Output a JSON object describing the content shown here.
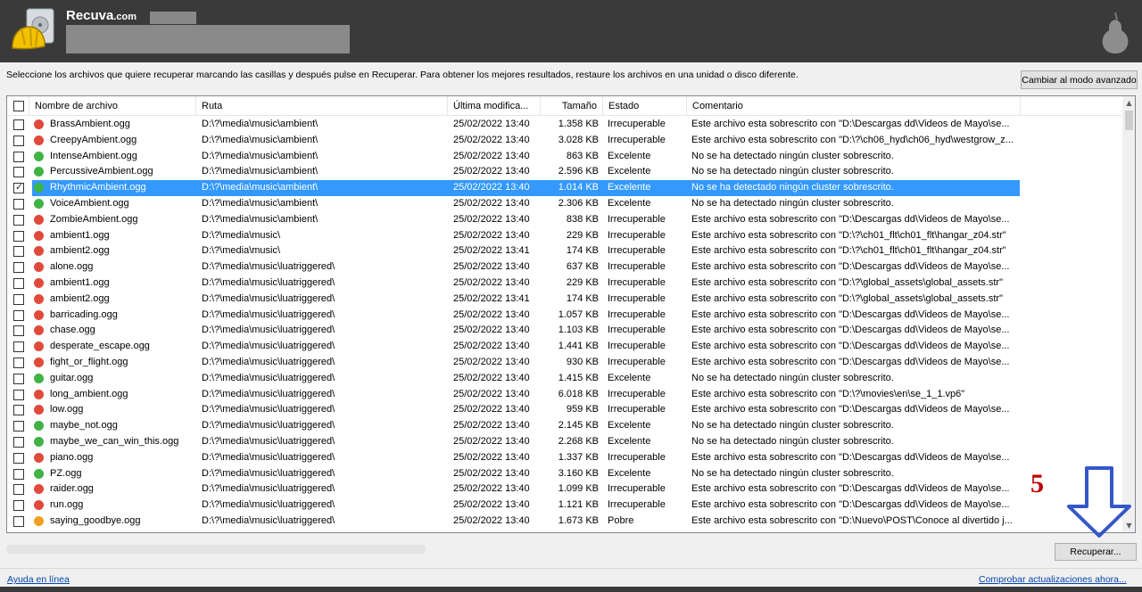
{
  "app": {
    "title": "Recuva",
    "title_suffix": ".com"
  },
  "instructions": "Seleccione los archivos que quiere recuperar marcando las casillas y después pulse en Recuperar. Para obtener los mejores resultados, restaure los archivos en una unidad o disco diferente.",
  "buttons": {
    "advanced": "Cambiar al modo avanzado",
    "recover": "Recuperar..."
  },
  "columns": [
    "Nombre de archivo",
    "Ruta",
    "Última modifica...",
    "Tamaño",
    "Estado",
    "Comentario"
  ],
  "status_colors": {
    "red": "#e04a3a",
    "green": "#3fb344",
    "orange": "#f0a020",
    "selected_row": "#3399ff"
  },
  "rows": [
    {
      "checked": false,
      "status": "red",
      "name": "BrassAmbient.ogg",
      "path": "D:\\?\\media\\music\\ambient\\",
      "date": "25/02/2022 13:40",
      "size": "1.358 KB",
      "state": "Irrecuperable",
      "comment": "Este archivo esta sobrescrito con \"D:\\Descargas dd\\Videos de Mayo\\se..."
    },
    {
      "checked": false,
      "status": "red",
      "name": "CreepyAmbient.ogg",
      "path": "D:\\?\\media\\music\\ambient\\",
      "date": "25/02/2022 13:40",
      "size": "3.028 KB",
      "state": "Irrecuperable",
      "comment": "Este archivo esta sobrescrito con \"D:\\?\\ch06_hyd\\ch06_hyd\\westgrow_z..."
    },
    {
      "checked": false,
      "status": "green",
      "name": "IntenseAmbient.ogg",
      "path": "D:\\?\\media\\music\\ambient\\",
      "date": "25/02/2022 13:40",
      "size": "863 KB",
      "state": "Excelente",
      "comment": "No se ha detectado ningún cluster sobrescrito."
    },
    {
      "checked": false,
      "status": "green",
      "name": "PercussiveAmbient.ogg",
      "path": "D:\\?\\media\\music\\ambient\\",
      "date": "25/02/2022 13:40",
      "size": "2.596 KB",
      "state": "Excelente",
      "comment": "No se ha detectado ningún cluster sobrescrito."
    },
    {
      "checked": true,
      "status": "green",
      "selected": true,
      "name": "RhythmicAmbient.ogg",
      "path": "D:\\?\\media\\music\\ambient\\",
      "date": "25/02/2022 13:40",
      "size": "1.014 KB",
      "state": "Excelente",
      "comment": "No se ha detectado ningún cluster sobrescrito."
    },
    {
      "checked": false,
      "status": "green",
      "name": "VoiceAmbient.ogg",
      "path": "D:\\?\\media\\music\\ambient\\",
      "date": "25/02/2022 13:40",
      "size": "2.306 KB",
      "state": "Excelente",
      "comment": "No se ha detectado ningún cluster sobrescrito."
    },
    {
      "checked": false,
      "status": "red",
      "name": "ZombieAmbient.ogg",
      "path": "D:\\?\\media\\music\\ambient\\",
      "date": "25/02/2022 13:40",
      "size": "838 KB",
      "state": "Irrecuperable",
      "comment": "Este archivo esta sobrescrito con \"D:\\Descargas dd\\Videos de Mayo\\se..."
    },
    {
      "checked": false,
      "status": "red",
      "name": "ambient1.ogg",
      "path": "D:\\?\\media\\music\\",
      "date": "25/02/2022 13:40",
      "size": "229 KB",
      "state": "Irrecuperable",
      "comment": "Este archivo esta sobrescrito con \"D:\\?\\ch01_flt\\ch01_flt\\hangar_z04.str\""
    },
    {
      "checked": false,
      "status": "red",
      "name": "ambient2.ogg",
      "path": "D:\\?\\media\\music\\",
      "date": "25/02/2022 13:41",
      "size": "174 KB",
      "state": "Irrecuperable",
      "comment": "Este archivo esta sobrescrito con \"D:\\?\\ch01_flt\\ch01_flt\\hangar_z04.str\""
    },
    {
      "checked": false,
      "status": "red",
      "name": "alone.ogg",
      "path": "D:\\?\\media\\music\\luatriggered\\",
      "date": "25/02/2022 13:40",
      "size": "637 KB",
      "state": "Irrecuperable",
      "comment": "Este archivo esta sobrescrito con \"D:\\Descargas dd\\Videos de Mayo\\se..."
    },
    {
      "checked": false,
      "status": "red",
      "name": "ambient1.ogg",
      "path": "D:\\?\\media\\music\\luatriggered\\",
      "date": "25/02/2022 13:40",
      "size": "229 KB",
      "state": "Irrecuperable",
      "comment": "Este archivo esta sobrescrito con \"D:\\?\\global_assets\\global_assets.str\""
    },
    {
      "checked": false,
      "status": "red",
      "name": "ambient2.ogg",
      "path": "D:\\?\\media\\music\\luatriggered\\",
      "date": "25/02/2022 13:41",
      "size": "174 KB",
      "state": "Irrecuperable",
      "comment": "Este archivo esta sobrescrito con \"D:\\?\\global_assets\\global_assets.str\""
    },
    {
      "checked": false,
      "status": "red",
      "name": "barricading.ogg",
      "path": "D:\\?\\media\\music\\luatriggered\\",
      "date": "25/02/2022 13:40",
      "size": "1.057 KB",
      "state": "Irrecuperable",
      "comment": "Este archivo esta sobrescrito con \"D:\\Descargas dd\\Videos de Mayo\\se..."
    },
    {
      "checked": false,
      "status": "red",
      "name": "chase.ogg",
      "path": "D:\\?\\media\\music\\luatriggered\\",
      "date": "25/02/2022 13:40",
      "size": "1.103 KB",
      "state": "Irrecuperable",
      "comment": "Este archivo esta sobrescrito con \"D:\\Descargas dd\\Videos de Mayo\\se..."
    },
    {
      "checked": false,
      "status": "red",
      "name": "desperate_escape.ogg",
      "path": "D:\\?\\media\\music\\luatriggered\\",
      "date": "25/02/2022 13:40",
      "size": "1.441 KB",
      "state": "Irrecuperable",
      "comment": "Este archivo esta sobrescrito con \"D:\\Descargas dd\\Videos de Mayo\\se..."
    },
    {
      "checked": false,
      "status": "red",
      "name": "fight_or_flight.ogg",
      "path": "D:\\?\\media\\music\\luatriggered\\",
      "date": "25/02/2022 13:40",
      "size": "930 KB",
      "state": "Irrecuperable",
      "comment": "Este archivo esta sobrescrito con \"D:\\Descargas dd\\Videos de Mayo\\se..."
    },
    {
      "checked": false,
      "status": "green",
      "name": "guitar.ogg",
      "path": "D:\\?\\media\\music\\luatriggered\\",
      "date": "25/02/2022 13:40",
      "size": "1.415 KB",
      "state": "Excelente",
      "comment": "No se ha detectado ningún cluster sobrescrito."
    },
    {
      "checked": false,
      "status": "red",
      "name": "long_ambient.ogg",
      "path": "D:\\?\\media\\music\\luatriggered\\",
      "date": "25/02/2022 13:40",
      "size": "6.018 KB",
      "state": "Irrecuperable",
      "comment": "Este archivo esta sobrescrito con \"D:\\?\\movies\\en\\se_1_1.vp6\""
    },
    {
      "checked": false,
      "status": "red",
      "name": "low.ogg",
      "path": "D:\\?\\media\\music\\luatriggered\\",
      "date": "25/02/2022 13:40",
      "size": "959 KB",
      "state": "Irrecuperable",
      "comment": "Este archivo esta sobrescrito con \"D:\\Descargas dd\\Videos de Mayo\\se..."
    },
    {
      "checked": false,
      "status": "green",
      "name": "maybe_not.ogg",
      "path": "D:\\?\\media\\music\\luatriggered\\",
      "date": "25/02/2022 13:40",
      "size": "2.145 KB",
      "state": "Excelente",
      "comment": "No se ha detectado ningún cluster sobrescrito."
    },
    {
      "checked": false,
      "status": "green",
      "name": "maybe_we_can_win_this.ogg",
      "path": "D:\\?\\media\\music\\luatriggered\\",
      "date": "25/02/2022 13:40",
      "size": "2.268 KB",
      "state": "Excelente",
      "comment": "No se ha detectado ningún cluster sobrescrito."
    },
    {
      "checked": false,
      "status": "red",
      "name": "piano.ogg",
      "path": "D:\\?\\media\\music\\luatriggered\\",
      "date": "25/02/2022 13:40",
      "size": "1.337 KB",
      "state": "Irrecuperable",
      "comment": "Este archivo esta sobrescrito con \"D:\\Descargas dd\\Videos de Mayo\\se..."
    },
    {
      "checked": false,
      "status": "green",
      "name": "PZ.ogg",
      "path": "D:\\?\\media\\music\\luatriggered\\",
      "date": "25/02/2022 13:40",
      "size": "3.160 KB",
      "state": "Excelente",
      "comment": "No se ha detectado ningún cluster sobrescrito."
    },
    {
      "checked": false,
      "status": "red",
      "name": "raider.ogg",
      "path": "D:\\?\\media\\music\\luatriggered\\",
      "date": "25/02/2022 13:40",
      "size": "1.099 KB",
      "state": "Irrecuperable",
      "comment": "Este archivo esta sobrescrito con \"D:\\Descargas dd\\Videos de Mayo\\se..."
    },
    {
      "checked": false,
      "status": "red",
      "name": "run.ogg",
      "path": "D:\\?\\media\\music\\luatriggered\\",
      "date": "25/02/2022 13:40",
      "size": "1.121 KB",
      "state": "Irrecuperable",
      "comment": "Este archivo esta sobrescrito con \"D:\\Descargas dd\\Videos de Mayo\\se..."
    },
    {
      "checked": false,
      "status": "orange",
      "name": "saying_goodbye.ogg",
      "path": "D:\\?\\media\\music\\luatriggered\\",
      "date": "25/02/2022 13:40",
      "size": "1.673 KB",
      "state": "Pobre",
      "comment": "Este archivo esta sobrescrito con \"D:\\Nuevo\\POST\\Conoce al divertido j..."
    }
  ],
  "links": {
    "help": "Ayuda en línea",
    "updates": "Comprobar actualizaciones ahora..."
  },
  "annotation": {
    "number": "5"
  }
}
